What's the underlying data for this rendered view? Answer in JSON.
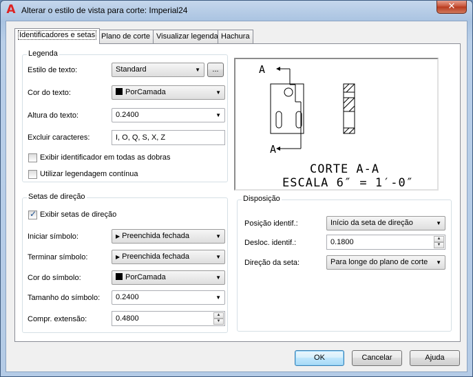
{
  "window": {
    "title": "Alterar o estilo de vista para corte: Imperial24",
    "close_glyph": "✕",
    "app_icon_glyph": "A"
  },
  "tabs": [
    {
      "label": "Identificadores e setas",
      "active": true
    },
    {
      "label": "Plano de corte",
      "active": false
    },
    {
      "label": "Visualizar legenda",
      "active": false
    },
    {
      "label": "Hachura",
      "active": false
    }
  ],
  "legenda": {
    "title": "Legenda",
    "text_style_label": "Estilo de texto:",
    "text_style_value": "Standard",
    "browse_label": "...",
    "text_color_label": "Cor do texto:",
    "text_color_value": "PorCamada",
    "text_height_label": "Altura do texto:",
    "text_height_value": "0.2400",
    "exclude_label": "Excluir caracteres:",
    "exclude_value": "I, O, Q, S, X, Z",
    "show_all_bends_label": "Exibir identificador em todas as dobras",
    "show_all_bends_checked": false,
    "continuous_label": "Utilizar legendagem contínua",
    "continuous_checked": false
  },
  "setas": {
    "title": "Setas de direção",
    "show_arrows_label": "Exibir setas de direção",
    "show_arrows_checked": true,
    "start_symbol_label": "Iniciar símbolo:",
    "start_symbol_value": "Preenchida fechada",
    "end_symbol_label": "Terminar símbolo:",
    "end_symbol_value": "Preenchida fechada",
    "symbol_color_label": "Cor do símbolo:",
    "symbol_color_value": "PorCamada",
    "symbol_size_label": "Tamanho do símbolo:",
    "symbol_size_value": "0.2400",
    "extension_label": "Compr. extensão:",
    "extension_value": "0.4800"
  },
  "disposicao": {
    "title": "Disposição",
    "position_label": "Posição identif.:",
    "position_value": "Início da seta de direção",
    "offset_label": "Desloc. identif.:",
    "offset_value": "0.1800",
    "direction_label": "Direção da seta:",
    "direction_value": "Para longe do plano de corte"
  },
  "preview": {
    "marker_top": "A",
    "marker_bottom": "A",
    "caption_line1": "CORTE A-A",
    "caption_line2": "ESCALA 6″ = 1′-0″"
  },
  "footer": {
    "ok_label": "OK",
    "cancel_label": "Cancelar",
    "help_label": "Ajuda"
  },
  "icons": {
    "dropdown_arrow": "▼",
    "spin_up": "▲",
    "spin_down": "▼",
    "filled_arrow": "▶"
  },
  "colors": {
    "title_bar": "#b4cbe6",
    "close_button": "#c8553a",
    "default_button": "#3c7fb1",
    "swatch": "#000000"
  }
}
